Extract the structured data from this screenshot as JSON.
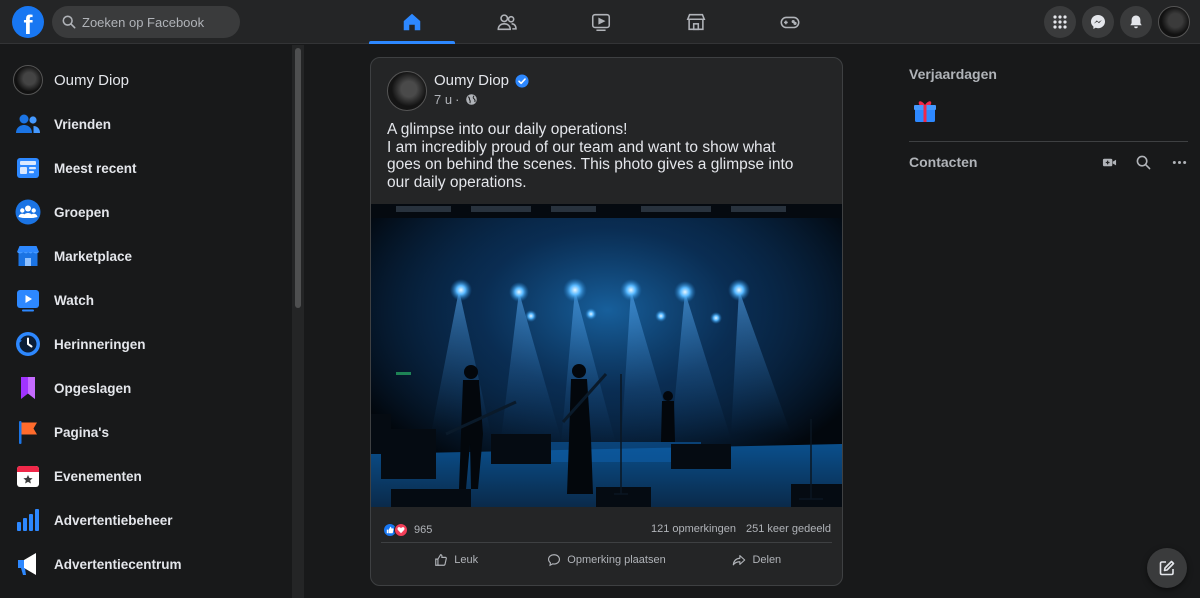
{
  "app": {
    "logo_letter": "f",
    "search_placeholder": "Zoeken op Facebook"
  },
  "nav": {
    "tabs": [
      {
        "name": "home",
        "icon": "home-icon",
        "active": true
      },
      {
        "name": "friends",
        "icon": "friends-icon",
        "active": false
      },
      {
        "name": "watch",
        "icon": "video-icon",
        "active": false
      },
      {
        "name": "marketplace",
        "icon": "store-icon",
        "active": false
      },
      {
        "name": "gaming",
        "icon": "gamepad-icon",
        "active": false
      }
    ],
    "right_buttons": [
      "menu-grid-icon",
      "messenger-icon",
      "notifications-bell-icon",
      "account-avatar"
    ]
  },
  "sidebar": {
    "profile_name": "Oumy Diop",
    "items": [
      {
        "label": "Vrienden",
        "icon": "friends-icon"
      },
      {
        "label": "Meest recent",
        "icon": "feeds-icon"
      },
      {
        "label": "Groepen",
        "icon": "groups-icon"
      },
      {
        "label": "Marketplace",
        "icon": "marketplace-icon"
      },
      {
        "label": "Watch",
        "icon": "watch-icon"
      },
      {
        "label": "Herinneringen",
        "icon": "memories-icon"
      },
      {
        "label": "Opgeslagen",
        "icon": "saved-icon"
      },
      {
        "label": "Pagina's",
        "icon": "pages-flag-icon"
      },
      {
        "label": "Evenementen",
        "icon": "events-icon"
      },
      {
        "label": "Advertentiebeheer",
        "icon": "ads-manager-icon"
      },
      {
        "label": "Advertentiecentrum",
        "icon": "ad-center-icon"
      }
    ]
  },
  "post": {
    "author": "Oumy Diop",
    "time": "7 u",
    "separator": "·",
    "text_lines": [
      "A glimpse into our daily operations!",
      "I am incredibly proud of our team and want to show what",
      "goes on behind the scenes. This photo gives a glimpse into",
      "our daily operations."
    ],
    "reaction_count": "965",
    "comments": "121 opmerkingen",
    "shares": "251 keer gedeeld",
    "actions": {
      "like": "Leuk",
      "comment": "Opmerking plaatsen",
      "share": "Delen"
    }
  },
  "right": {
    "birthdays_heading": "Verjaardagen",
    "contacts_heading": "Contacten"
  },
  "colors": {
    "background": "#18191a",
    "surface": "#242526",
    "accent": "#2d88ff",
    "brand": "#1877f2"
  }
}
